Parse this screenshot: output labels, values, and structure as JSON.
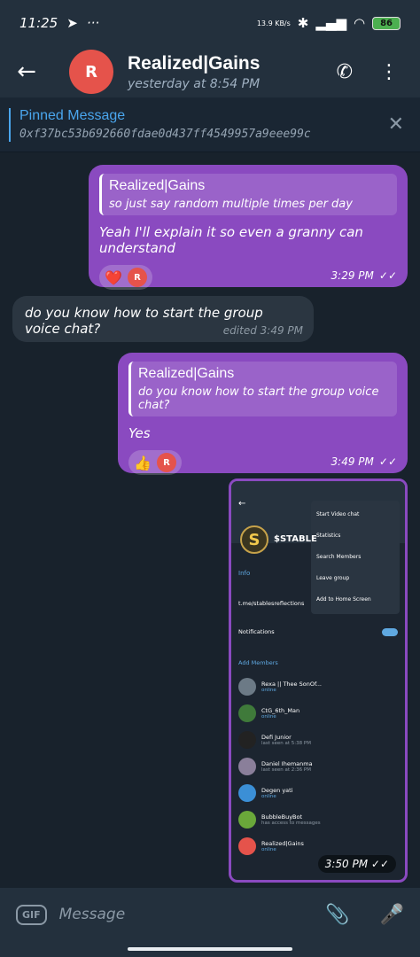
{
  "status": {
    "time": "11:25",
    "speed": "13.9 KB/s",
    "battery": "86"
  },
  "header": {
    "avatar_initial": "R",
    "title": "Realized|Gains",
    "subtitle": "yesterday at 8:54 PM"
  },
  "pinned": {
    "title": "Pinned Message",
    "body": "0xf37bc53b692660fdae0d437ff4549957a9eee99c"
  },
  "messages": [
    {
      "reply_name": "Realized|Gains",
      "reply_text": "so just say random multiple times per day",
      "text": "Yeah I'll explain it so even a granny can understand",
      "reaction": "❤️",
      "react_initial": "R",
      "time": "3:29 PM"
    },
    {
      "text": "do you know how to start the group voice chat?",
      "time": "edited 3:49 PM"
    },
    {
      "reply_name": "Realized|Gains",
      "reply_text": "do you know how to start the group voice chat?",
      "text": "Yes",
      "reaction": "👍",
      "react_initial": "R",
      "time": "3:49 PM"
    }
  ],
  "screenshot": {
    "time_overlay": "3:50 PM",
    "title": "$STABLE",
    "menu": [
      "Start Video chat",
      "Statistics",
      "Search Members",
      "Leave group",
      "Add to Home Screen"
    ],
    "info_label": "Info",
    "link": "t.me/stablesreflections",
    "notifications": "Notifications",
    "add_members": "Add Members",
    "members": [
      {
        "name": "Rexa || Thee SonOf...",
        "sub": "online"
      },
      {
        "name": "CtG_6th_Man",
        "sub": "online"
      },
      {
        "name": "Defi Junior",
        "sub": "last seen at 5:38 PM"
      },
      {
        "name": "Daniel Ihemanma",
        "sub": "last seen at 2:36 PM"
      },
      {
        "name": "Degen yati",
        "sub": "online"
      },
      {
        "name": "BubbleBuyBot",
        "sub": "has access to messages"
      },
      {
        "name": "Realized|Gains",
        "sub": "online"
      }
    ]
  },
  "input": {
    "gif": "GIF",
    "placeholder": "Message"
  }
}
